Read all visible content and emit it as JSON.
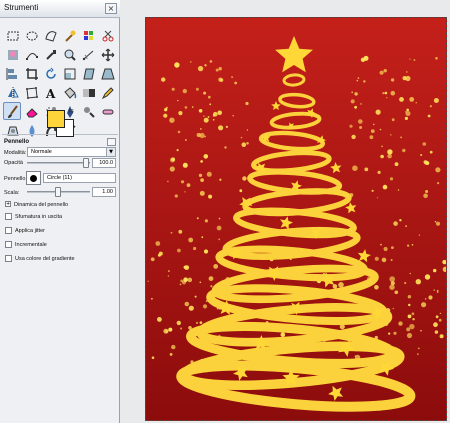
{
  "window": {
    "title": "Strumenti"
  },
  "toolbox": {
    "tools": [
      {
        "name": "rect-select-icon",
        "active": false
      },
      {
        "name": "ellipse-select-icon",
        "active": false
      },
      {
        "name": "free-select-icon",
        "active": false
      },
      {
        "name": "fuzzy-select-icon",
        "active": false
      },
      {
        "name": "color-select-icon",
        "active": false
      },
      {
        "name": "scissors-icon",
        "active": false
      },
      {
        "name": "foreground-select-icon",
        "active": false
      },
      {
        "name": "paths-icon",
        "active": false
      },
      {
        "name": "color-picker-icon",
        "active": false
      },
      {
        "name": "zoom-icon",
        "active": false
      },
      {
        "name": "measure-icon",
        "active": false
      },
      {
        "name": "move-icon",
        "active": false
      },
      {
        "name": "align-icon",
        "active": false
      },
      {
        "name": "crop-icon",
        "active": false
      },
      {
        "name": "rotate-icon",
        "active": false
      },
      {
        "name": "scale-icon",
        "active": false
      },
      {
        "name": "shear-icon",
        "active": false
      },
      {
        "name": "perspective-icon",
        "active": false
      },
      {
        "name": "flip-icon",
        "active": false
      },
      {
        "name": "cage-icon",
        "active": false
      },
      {
        "name": "text-icon",
        "active": false
      },
      {
        "name": "bucket-fill-icon",
        "active": false
      },
      {
        "name": "blend-icon",
        "active": false
      },
      {
        "name": "pencil-icon",
        "active": false
      },
      {
        "name": "paintbrush-icon",
        "active": true
      },
      {
        "name": "eraser-icon",
        "active": false
      },
      {
        "name": "airbrush-icon",
        "active": false
      },
      {
        "name": "ink-icon",
        "active": false
      },
      {
        "name": "clone-icon",
        "active": false
      },
      {
        "name": "heal-icon",
        "active": false
      },
      {
        "name": "perspective-clone-icon",
        "active": false
      },
      {
        "name": "blur-icon",
        "active": false
      },
      {
        "name": "smudge-icon",
        "active": false
      },
      {
        "name": "dodge-burn-icon",
        "active": false
      }
    ],
    "foreground_color": "#fdd43a",
    "background_color": "#ffffff"
  },
  "options": {
    "title": "Pennello",
    "mode_label": "Modalità:",
    "mode_value": "Normale",
    "opacity_label": "Opacità",
    "opacity_value": "100.0",
    "opacity_fraction": 1.0,
    "brush_label": "Pennello",
    "brush_value": "Circle (11)",
    "scale_label": "Scala:",
    "scale_value": "1.00",
    "scale_fraction": 0.5,
    "dynamics_label": "Dinamica del pennello",
    "checkboxes": [
      {
        "label": "Sfumatura in uscita",
        "checked": false
      },
      {
        "label": "Applica jitter",
        "checked": false
      },
      {
        "label": "Incrementale",
        "checked": false
      },
      {
        "label": "Usa colore del gradiente",
        "checked": false
      }
    ]
  },
  "canvas": {
    "background_top": "#c4201a",
    "background_bottom": "#8c0c0c",
    "ribbon_color": "#fcd23c",
    "star_color": "#ffd736",
    "sparkle_color": "#ffe25a"
  }
}
